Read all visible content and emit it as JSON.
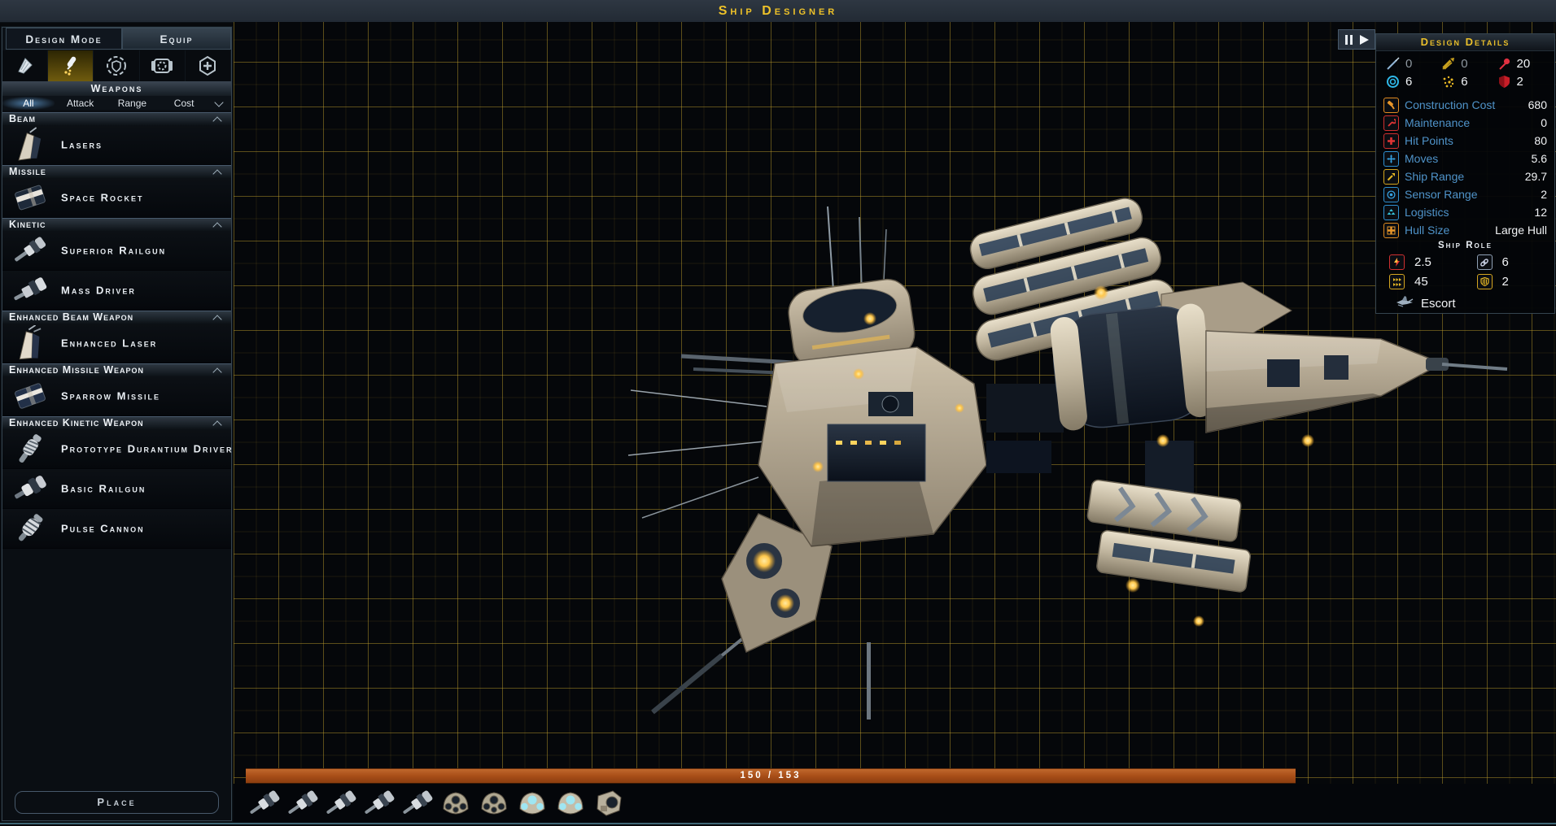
{
  "title_bar": {
    "title": "Ship Designer"
  },
  "left_panel": {
    "tabs": [
      {
        "label": "Design Mode",
        "active": false
      },
      {
        "label": "Equip",
        "active": true
      }
    ],
    "category_icons": [
      "armor-icon",
      "weapons-icon",
      "defense-icon",
      "engine-icon",
      "support-icon"
    ],
    "selected_category": "weapons",
    "section_title": "Weapons",
    "filters": [
      "All",
      "Attack",
      "Range",
      "Cost"
    ],
    "selected_filter": "All",
    "groups": [
      {
        "header": "Beam",
        "items": [
          {
            "name": "Lasers",
            "icon": "laser-thumbnail-icon"
          }
        ]
      },
      {
        "header": "Missile",
        "items": [
          {
            "name": "Space Rocket",
            "icon": "missile-thumbnail-icon"
          }
        ]
      },
      {
        "header": "Kinetic",
        "items": [
          {
            "name": "Superior Railgun",
            "icon": "railgun-thumbnail-icon"
          },
          {
            "name": "Mass Driver",
            "icon": "railgun-thumbnail-icon"
          }
        ]
      },
      {
        "header": "Enhanced Beam Weapon",
        "items": [
          {
            "name": "Enhanced Laser",
            "icon": "laser-thumbnail-icon"
          }
        ]
      },
      {
        "header": "Enhanced Missile Weapon",
        "items": [
          {
            "name": "Sparrow Missile",
            "icon": "missile-thumbnail-icon"
          }
        ]
      },
      {
        "header": "Enhanced Kinetic Weapon",
        "items": [
          {
            "name": "Prototype Durantium Driver",
            "icon": "coil-thumbnail-icon"
          },
          {
            "name": "Basic Railgun",
            "icon": "railgun-thumbnail-icon"
          },
          {
            "name": "Pulse Cannon",
            "icon": "coil-thumbnail-icon"
          }
        ]
      }
    ],
    "place_label": "Place"
  },
  "viewport_controls": {
    "icons": [
      "pause-icon",
      "play-icon"
    ]
  },
  "design_details": {
    "title": "Design Details",
    "weapon_defense": [
      {
        "icon": "beam-attack-icon",
        "value": "0",
        "muted": true
      },
      {
        "icon": "kinetic-attack-icon",
        "value": "0",
        "muted": true
      },
      {
        "icon": "missile-attack-icon",
        "value": "20",
        "muted": false
      },
      {
        "icon": "shield-defense-icon",
        "value": "6",
        "muted": false
      },
      {
        "icon": "point-defense-icon",
        "value": "6",
        "muted": false
      },
      {
        "icon": "armor-defense-icon",
        "value": "2",
        "muted": false
      }
    ],
    "stats": [
      {
        "icon": "hammer-icon",
        "label": "Construction Cost",
        "value": "680"
      },
      {
        "icon": "wrench-icon",
        "label": "Maintenance",
        "value": "0"
      },
      {
        "icon": "cross-icon",
        "label": "Hit Points",
        "value": "80"
      },
      {
        "icon": "move-arrows-icon",
        "label": "Moves",
        "value": "5.6"
      },
      {
        "icon": "rocket-icon",
        "label": "Ship Range",
        "value": "29.7"
      },
      {
        "icon": "sensor-icon",
        "label": "Sensor Range",
        "value": "2"
      },
      {
        "icon": "logistics-icon",
        "label": "Logistics",
        "value": "12"
      },
      {
        "icon": "hull-icon",
        "label": "Hull Size",
        "value": "Large Hull"
      }
    ],
    "ship_role": {
      "title": "Ship Role",
      "stats": [
        {
          "icon": "attack-bolt-icon",
          "value": "2.5"
        },
        {
          "icon": "chain-icon",
          "value": "6"
        },
        {
          "icon": "speed-arrows-icon",
          "value": "45"
        },
        {
          "icon": "role-shield-icon",
          "value": "2"
        }
      ],
      "role_icon": "escort-ship-icon",
      "role": "Escort"
    }
  },
  "bottom_bar": {
    "capacity_text": "150 / 153",
    "slots": [
      "railgun",
      "railgun",
      "railgun",
      "railgun",
      "railgun",
      "pod",
      "pod",
      "pod-lit",
      "pod-lit",
      "module"
    ]
  },
  "colors": {
    "title_gold": "#eec229",
    "label_blue": "#4f93c9",
    "bar_orange": "#a84e18",
    "grid_yellow": "#c4a32d",
    "value_white": "#f2f4f6",
    "muted_gray": "#8e979f",
    "selected_cell_gold": "#6f5b0e",
    "panel_border": "#35444f"
  }
}
